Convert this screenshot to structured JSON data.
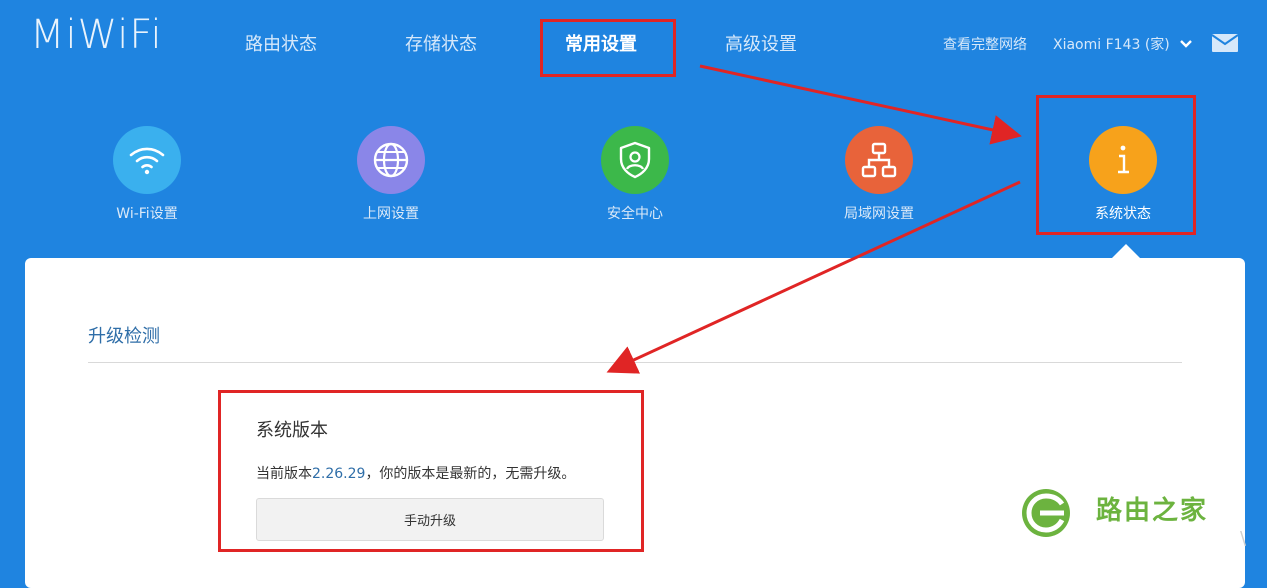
{
  "header": {
    "logo": "MiWiFi",
    "nav": [
      {
        "label": "路由状态",
        "active": false
      },
      {
        "label": "存储状态",
        "active": false
      },
      {
        "label": "常用设置",
        "active": true
      },
      {
        "label": "高级设置",
        "active": false
      }
    ],
    "view_network": "查看完整网络",
    "router_name": "Xiaomi F143 (家)"
  },
  "icons": [
    {
      "label": "Wi-Fi设置",
      "icon": "wifi-icon",
      "color": "#3ab0ee"
    },
    {
      "label": "上网设置",
      "icon": "globe-icon",
      "color": "#8a86e8"
    },
    {
      "label": "安全中心",
      "icon": "shield-icon",
      "color": "#3cb84a"
    },
    {
      "label": "局域网设置",
      "icon": "network-icon",
      "color": "#e8633a"
    },
    {
      "label": "系统状态",
      "icon": "info-icon",
      "color": "#f7a21b"
    }
  ],
  "panel": {
    "section_title": "升级检测",
    "version_title": "系统版本",
    "version_prefix": "当前版本",
    "version_number": "2.26.29",
    "version_suffix": "，你的版本是最新的，无需升级。",
    "upgrade_button": "手动升级"
  },
  "watermark": {
    "text": "路由之家"
  },
  "colors": {
    "background": "#1f84e0",
    "highlight": "#e02525",
    "link": "#2f6ea8"
  }
}
